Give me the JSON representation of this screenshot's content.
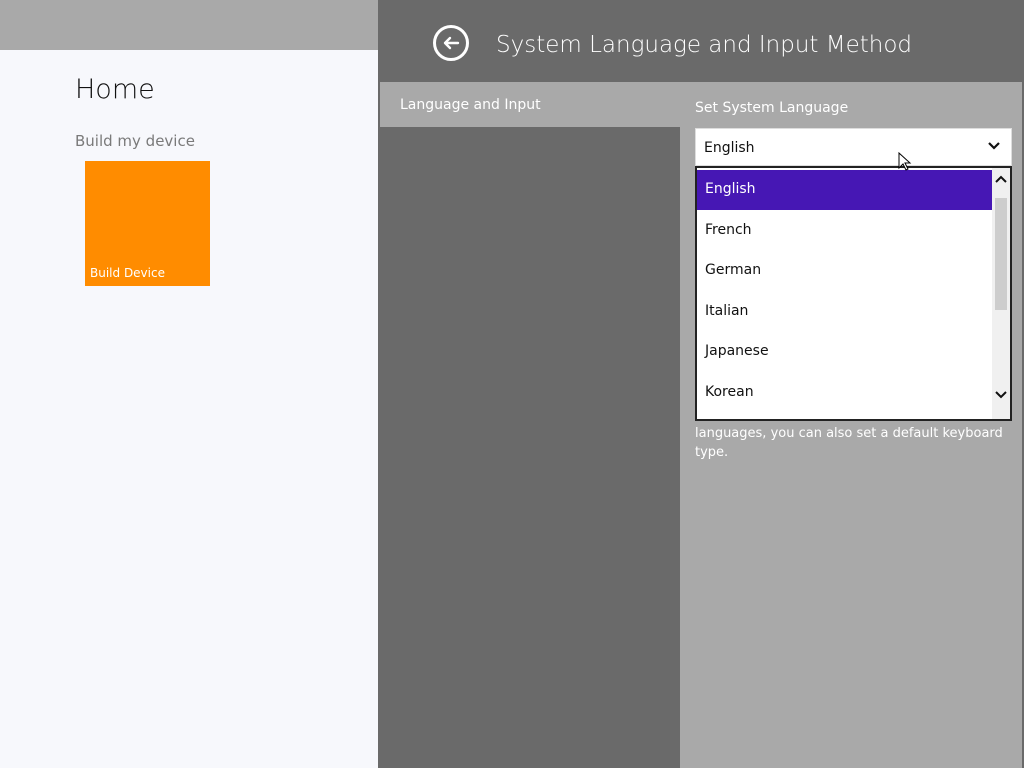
{
  "home": {
    "title": "Home",
    "group_label": "Build my device",
    "tile_label": "Build Device",
    "tile_color": "#ff8c00"
  },
  "flyout": {
    "title": "System Language and Input Method",
    "nav_item": "Language and Input",
    "section_label": "Set System Language",
    "selected_language": "English",
    "options": [
      "English",
      "French",
      "German",
      "Italian",
      "Japanese",
      "Korean"
    ],
    "description": "languages, you can also set a default keyboard type.",
    "selection_color": "#4617b4"
  },
  "icons": {
    "back": "back-arrow-icon",
    "chevron": "chevron-down-icon",
    "scroll_up": "chevron-up-icon",
    "scroll_down": "chevron-down-icon",
    "cursor": "mouse-pointer-icon"
  }
}
